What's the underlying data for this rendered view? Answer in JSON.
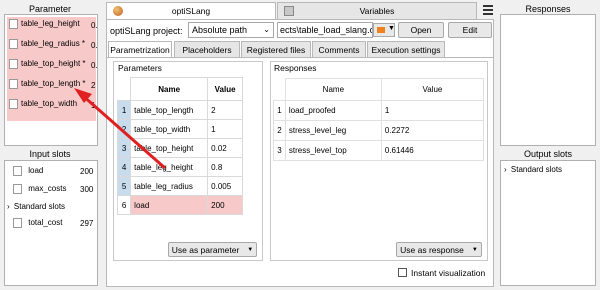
{
  "left": {
    "parameter_header": "Parameter",
    "parameter_items": [
      "table_leg_height",
      "table_leg_radius *",
      "table_top_height *",
      "table_top_length *",
      "table_top_width"
    ],
    "parameter_suffixes": [
      "0.",
      "0.",
      "0.",
      "2",
      "1."
    ],
    "input_slots_header": "Input slots",
    "input_slots": [
      {
        "name": "load",
        "value": "200"
      },
      {
        "name": "max_costs",
        "value": "300"
      }
    ],
    "standard_slots": "Standard slots",
    "standard_items": [
      {
        "name": "total_cost",
        "value": "297"
      }
    ]
  },
  "tabs_top": {
    "optislang": "optiSLang",
    "variables": "Variables"
  },
  "project": {
    "label": "optiSLang project:",
    "path_mode": "Absolute path",
    "path_value": "ects\\table_load_slang.o",
    "open_label": "Open",
    "edit_label": "Edit"
  },
  "sub_tabs": [
    "Parametrization",
    "Placeholders",
    "Registered files",
    "Comments",
    "Execution settings"
  ],
  "parameters": {
    "title": "Parameters",
    "col_name": "Name",
    "col_value": "Value",
    "rows": [
      {
        "num": "1",
        "name": "table_top_length",
        "value": "2"
      },
      {
        "num": "2",
        "name": "table_top_width",
        "value": "1"
      },
      {
        "num": "3",
        "name": "table_top_height",
        "value": "0.02"
      },
      {
        "num": "4",
        "name": "table_leg_height",
        "value": "0.8"
      },
      {
        "num": "5",
        "name": "table_leg_radius",
        "value": "0.005"
      },
      {
        "num": "6",
        "name": "load",
        "value": "200"
      }
    ],
    "use_as_parameter": "Use as parameter"
  },
  "responses": {
    "title": "Responses",
    "col_name": "Name",
    "col_value": "Value",
    "rows": [
      {
        "num": "1",
        "name": "load_proofed",
        "value": "1"
      },
      {
        "num": "2",
        "name": "stress_level_leg",
        "value": "0.2272"
      },
      {
        "num": "3",
        "name": "stress_level_top",
        "value": "0.61446"
      }
    ],
    "use_as_response": "Use as response"
  },
  "instant_visualization": "Instant visualization",
  "right": {
    "responses_header": "Responses",
    "output_slots_header": "Output slots",
    "standard_slots": "Standard slots"
  },
  "colors": {
    "highlight": "#f8c9c9",
    "selection": "#c8dced",
    "arrow": "#e02020"
  }
}
